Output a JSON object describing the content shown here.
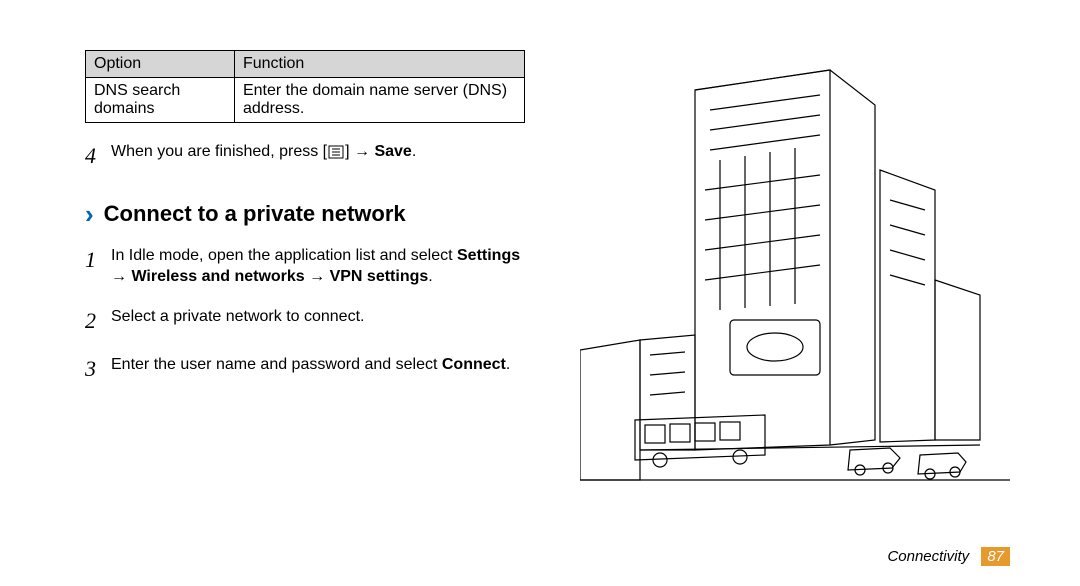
{
  "table": {
    "headers": [
      "Option",
      "Function"
    ],
    "rows": [
      {
        "option": "DNS search domains",
        "function": "Enter the domain name server (DNS) address."
      }
    ]
  },
  "step4": {
    "num": "4",
    "before": "When you are finished, press [",
    "after": "] → ",
    "bold": "Save",
    "end": "."
  },
  "section": {
    "chevron": "›",
    "title": "Connect to a private network"
  },
  "steps": [
    {
      "num": "1",
      "line1": "In Idle mode, open the application list and select ",
      "bold": "Settings → Wireless and networks → VPN settings",
      "end": "."
    },
    {
      "num": "2",
      "line1": "Select a private network to connect.",
      "bold": "",
      "end": ""
    },
    {
      "num": "3",
      "line1": "Enter the user name and password and select ",
      "bold": "Connect",
      "end": "."
    }
  ],
  "footer": {
    "label": "Connectivity",
    "page": "87"
  },
  "illustration_alt": "Line drawing of a city street with buildings and a bus"
}
